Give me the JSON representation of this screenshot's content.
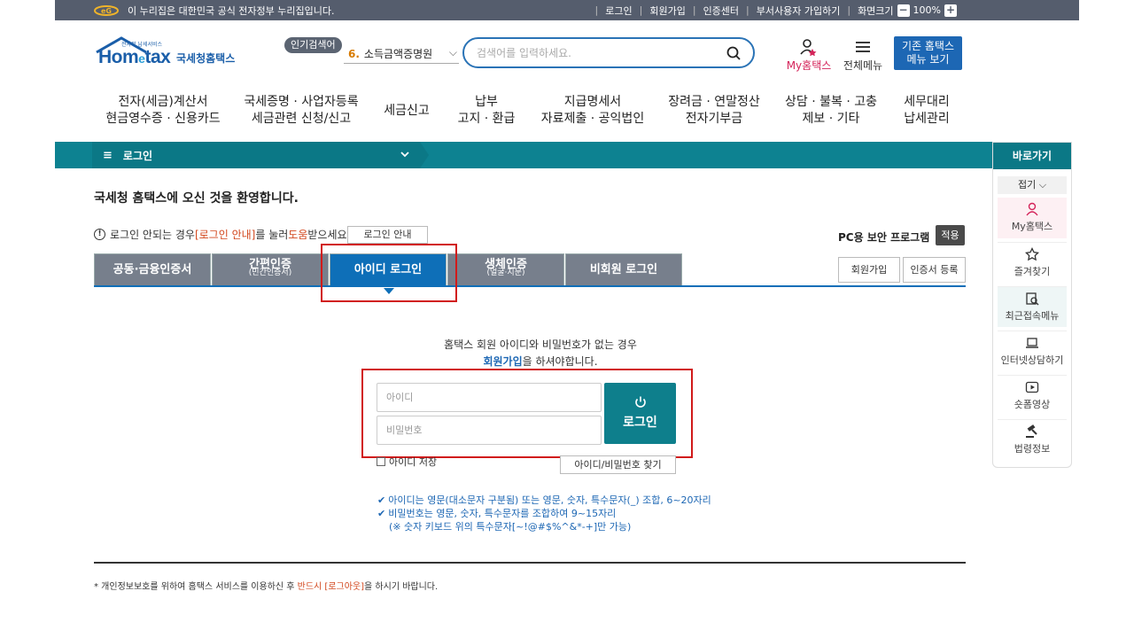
{
  "govbar": {
    "text": "이 누리집은 대한민국 공식 전자정부 누리집입니다.",
    "links": [
      "로그인",
      "회원가입",
      "인증센터",
      "부서사용자 가입하기",
      "화면크기"
    ],
    "zoom": "100%",
    "zoom_minus": "−",
    "zoom_plus": "+"
  },
  "header": {
    "logo_brand": "Hom",
    "logo_brand_e": "e",
    "logo_brand_tail": "tax",
    "logo_tiny": "전자적 납세서비스",
    "logo_kor": "국세청홈택스",
    "popular_tag": "인기검색어",
    "popular_num": "6.",
    "popular_item": "소득금액증명원",
    "search_placeholder": "검색어를 입력하세요.",
    "my_home": "My홈택스",
    "all_menu": "전체메뉴",
    "classic_line1": "기존 홈택스",
    "classic_line2": "메뉴 보기"
  },
  "gnb": [
    {
      "l1": "전자(세금)계산서",
      "l2": "현금영수증 · 신용카드"
    },
    {
      "l1": "국세증명 · 사업자등록",
      "l2": "세금관련 신청/신고"
    },
    {
      "l1": "세금신고",
      "l2": ""
    },
    {
      "l1": "납부",
      "l2": "고지 · 환급"
    },
    {
      "l1": "지급명세서",
      "l2": "자료제출 · 공익법인"
    },
    {
      "l1": "장려금 · 연말정산",
      "l2": "전자기부금"
    },
    {
      "l1": "상담 · 불복 · 고충",
      "l2": "제보 · 기타"
    },
    {
      "l1": "세무대리",
      "l2": "납세관리"
    }
  ],
  "location": {
    "menu_icon": "≡",
    "current": "로그인"
  },
  "quick": {
    "title": "바로가기",
    "fold": "접기",
    "items": [
      "My홈택스",
      "즐겨찾기",
      "최근접속메뉴",
      "인터넷상담하기",
      "숏폼영상",
      "법령정보"
    ]
  },
  "content": {
    "welcome": "국세청 홈택스에 오신 것을 환영합니다.",
    "help_pre": "로그인 안되는 경우 ",
    "help_link": "[로그인 안내]",
    "help_mid": "를 눌러 ",
    "help_red2": "도움",
    "help_post": "받으세요.",
    "guide_btn": "로그인 안내",
    "pc_security": "PC용 보안 프로그램",
    "apply": "적용",
    "join": "회원가입",
    "cert_register": "인증서 등록"
  },
  "tabs": [
    {
      "label": "공동·금융인증서",
      "sub": ""
    },
    {
      "label": "간편인증",
      "sub": "(민간인증서)"
    },
    {
      "label": "아이디 로그인",
      "sub": ""
    },
    {
      "label": "생체인증",
      "sub": "(얼굴·지문)"
    },
    {
      "label": "비회원 로그인",
      "sub": ""
    }
  ],
  "login": {
    "notice_line1": "홈택스 회원 아이디와 비밀번호가 없는 경우",
    "notice_link": "회원가입",
    "notice_line2_tail": "을 하셔야합니다.",
    "id_placeholder": "아이디",
    "pw_placeholder": "비밀번호",
    "login_btn": "로그인",
    "save_id": "아이디 저장",
    "find_btn": "아이디/비밀번호 찾기"
  },
  "rules": {
    "r1": "아이디는 영문(대소문자 구분됨) 또는 영문, 숫자, 특수문자(_) 조합, 6~20자리",
    "r2": "비밀번호는 영문, 숫자, 특수문자를 조합하여 9~15자리",
    "r3": "(※ 숫자 키보드 위의 특수문자[~!@#$%^&*-+]만 가능)"
  },
  "privacy": {
    "pre": "* 개인정보보호를 위하여 홈택스 서비스를 이용하신 후 ",
    "red": "반드시 [로그아웃]",
    "post": "을 하시기 바랍니다."
  },
  "colors": {
    "accent_teal": "#0e7f8c",
    "accent_blue": "#0e6fb8",
    "highlight_red": "#d11a1a"
  }
}
